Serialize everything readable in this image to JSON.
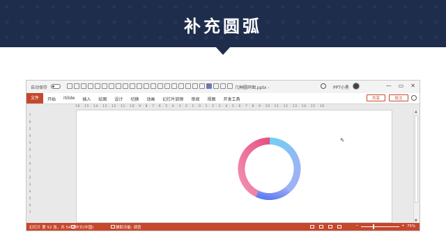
{
  "banner": {
    "title": "补充圆弧"
  },
  "window": {
    "autosave_label": "自动保存",
    "doc_title": "几种圆环图.pptx -",
    "user_name": "PPT小黑",
    "controls": [
      "—",
      "▭",
      "✕"
    ]
  },
  "ribbon": {
    "file_tab": "文件",
    "tabs": [
      "开始",
      "iSlide",
      "插入",
      "绘图",
      "设计",
      "切换",
      "动画",
      "幻灯片放映",
      "审阅",
      "视图",
      "开发工具"
    ],
    "share_label": "共享",
    "comment_label": "批注"
  },
  "ruler": {
    "horizontal": "16 · 15 · 14 · 13 · 12 · 11 · 10 · 9 · 8 · 7 · 6 · 5 · 4 · 3 · 2 · 1 · 0 · 1 · 2 · 3 · 4 · 5 · 6 · 7 · 8 · 9 · 10 · 11 · 12 · 13 · 14 · 15 · 16",
    "vertical": [
      "7",
      "6",
      "5",
      "4",
      "3",
      "2",
      "1",
      "0",
      "1",
      "2",
      "3",
      "4",
      "5",
      "6",
      "7"
    ]
  },
  "status": {
    "slide_info": "幻灯片 第 52 张，共 54 张",
    "language": "中文(中国)",
    "accessibility": "辅助功能: 调查",
    "zoom_minus": "−",
    "zoom_plus": "+",
    "zoom": "75%",
    "zoom_fraction": 0.3
  },
  "donut": {
    "colors": [
      "#5ec8f0",
      "#9aa6f5",
      "#6f86f0",
      "#f07fa6",
      "#e85a8a"
    ]
  }
}
